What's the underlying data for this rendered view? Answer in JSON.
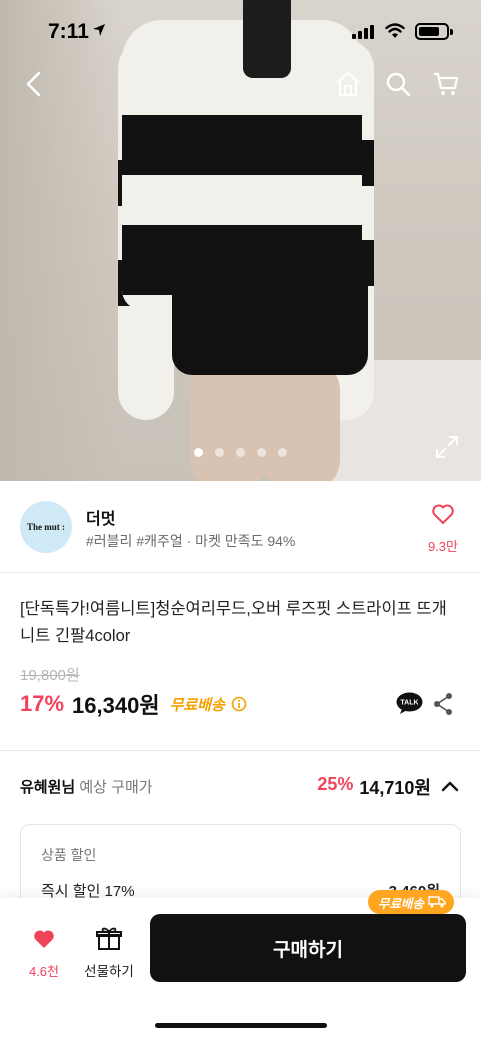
{
  "status_bar": {
    "time": "7:11"
  },
  "product": {
    "title": "[단독특가!여름니트]청순여리무드,오버 루즈핏 스트라이프 뜨개 니트 긴팔4color",
    "original_price": "19,800원",
    "discount_rate": "17%",
    "price": "16,340원",
    "shipping": "무료배송",
    "image_count": 5,
    "image_index": 1
  },
  "seller": {
    "logo_text": "The mut :",
    "name": "더멋",
    "tags": "#러블리 #캐주얼 · 마켓 만족도 94%",
    "like_count": "9.3만"
  },
  "member": {
    "name": "유혜원님",
    "label": "예상 구매가",
    "discount_rate": "25%",
    "price": "14,710원"
  },
  "discount_details": {
    "heading": "상품 할인",
    "rows": [
      {
        "label": "즉시 할인 17%",
        "value": "-3,460원"
      }
    ]
  },
  "bottom_bar": {
    "wish_count": "4.6천",
    "gift_label": "선물하기",
    "buy_label": "구매하기",
    "free_ship_badge": "무료배송"
  },
  "colors": {
    "accent": "#f0435a",
    "shipping": "#f5a000",
    "button": "#111111",
    "badge": "#ffa51f"
  },
  "icons": [
    "back-icon",
    "home-icon",
    "search-icon",
    "cart-icon",
    "expand-icon",
    "heart-icon",
    "info-icon",
    "talk-icon",
    "share-icon",
    "chevron-up-icon",
    "gift-icon",
    "truck-icon"
  ]
}
